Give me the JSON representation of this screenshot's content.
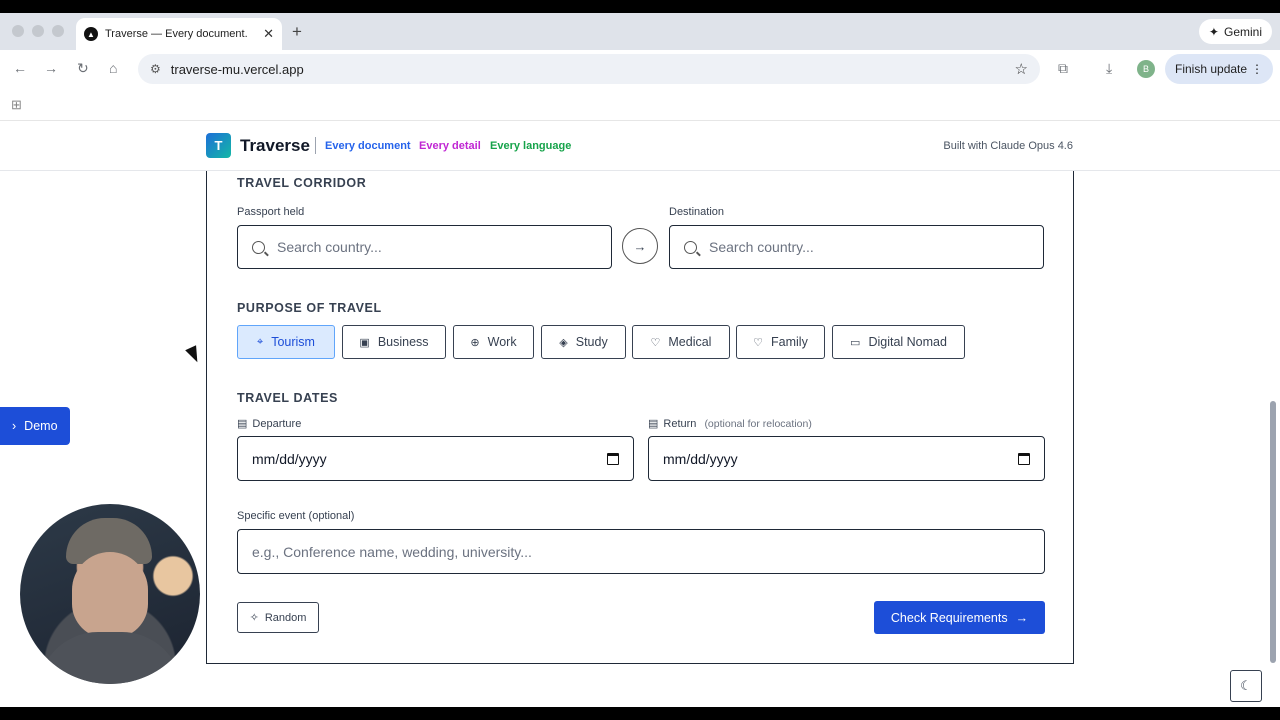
{
  "browser": {
    "tab_title": "Traverse — Every document.",
    "tab_favicon": "▲",
    "url": "traverse-mu.vercel.app",
    "gemini_label": "Gemini",
    "profile_initial": "B",
    "finish_update_label": "Finish update"
  },
  "header": {
    "logo_letter": "T",
    "brand": "Traverse",
    "taglines": [
      {
        "text": "Every document",
        "color": "#2563eb"
      },
      {
        "text": "Every detail",
        "color": "#c026d3"
      },
      {
        "text": "Every language",
        "color": "#16a34a"
      }
    ],
    "built_with": "Built with Claude Opus 4.6"
  },
  "corridor": {
    "title": "TRAVEL CORRIDOR",
    "passport_label": "Passport held",
    "passport_placeholder": "Search country...",
    "destination_label": "Destination",
    "destination_placeholder": "Search country...",
    "swap_icon": "arrow-right-icon"
  },
  "purpose": {
    "title": "PURPOSE OF TRAVEL",
    "options": [
      {
        "label": "Tourism",
        "icon": "pin-icon",
        "glyph": "⌖",
        "active": true
      },
      {
        "label": "Business",
        "icon": "briefcase-icon",
        "glyph": "▣",
        "active": false
      },
      {
        "label": "Work",
        "icon": "globe-icon",
        "glyph": "⊕",
        "active": false
      },
      {
        "label": "Study",
        "icon": "graduation-cap-icon",
        "glyph": "◈",
        "active": false
      },
      {
        "label": "Medical",
        "icon": "stethoscope-icon",
        "glyph": "♡",
        "active": false
      },
      {
        "label": "Family",
        "icon": "heart-icon",
        "glyph": "♡",
        "active": false
      },
      {
        "label": "Digital Nomad",
        "icon": "laptop-icon",
        "glyph": "▭",
        "active": false
      }
    ]
  },
  "dates": {
    "title": "TRAVEL DATES",
    "departure_label": "Departure",
    "departure_value": "mm/dd/yyyy",
    "return_label": "Return",
    "return_note": "(optional for relocation)",
    "return_value": "mm/dd/yyyy"
  },
  "event": {
    "label": "Specific event (optional)",
    "placeholder": "e.g., Conference name, wedding, university..."
  },
  "actions": {
    "random_label": "Random",
    "check_label": "Check Requirements",
    "check_arrow": "→"
  },
  "overlay": {
    "demo_label": "Demo",
    "demo_chevron": "›"
  },
  "colors": {
    "primary": "#1d4ed8",
    "active_chip_bg": "#dbeafe"
  }
}
